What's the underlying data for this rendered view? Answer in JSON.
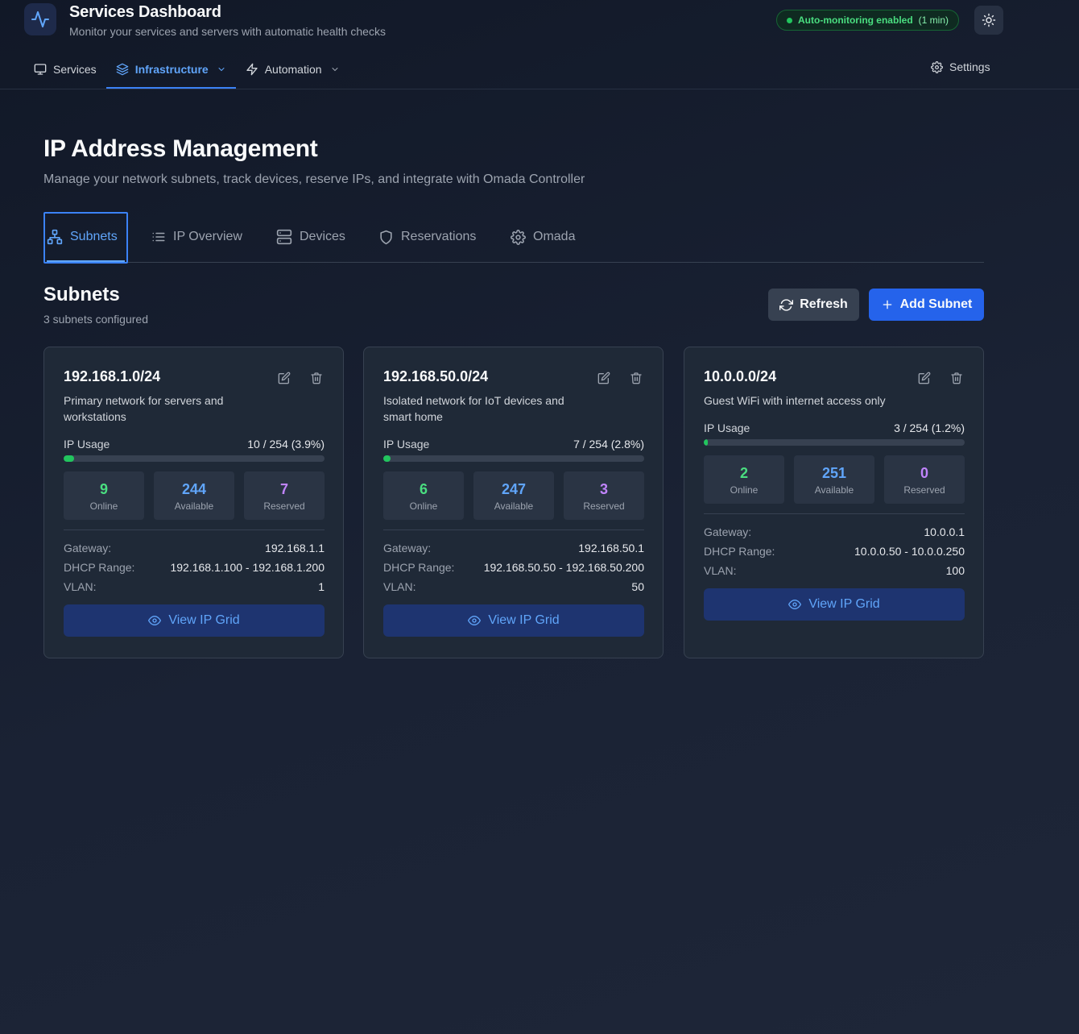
{
  "app": {
    "title": "Services Dashboard",
    "subtitle": "Monitor your services and servers with automatic health checks",
    "monitor_badge": {
      "label": "Auto-monitoring enabled",
      "interval": "(1 min)"
    }
  },
  "nav": {
    "items": [
      {
        "label": "Services",
        "icon": "monitor-icon"
      },
      {
        "label": "Infrastructure",
        "icon": "layers-icon",
        "active": true
      },
      {
        "label": "Automation",
        "icon": "zap-icon"
      }
    ],
    "settings_label": "Settings"
  },
  "page": {
    "title": "IP Address Management",
    "description": "Manage your network subnets, track devices, reserve IPs, and integrate with Omada Controller"
  },
  "tabs": [
    {
      "label": "Subnets",
      "icon": "network-icon",
      "active": true
    },
    {
      "label": "IP Overview",
      "icon": "list-icon"
    },
    {
      "label": "Devices",
      "icon": "server-icon"
    },
    {
      "label": "Reservations",
      "icon": "shield-icon"
    },
    {
      "label": "Omada",
      "icon": "gear-icon"
    }
  ],
  "section": {
    "title": "Subnets",
    "subtitle": "3 subnets configured",
    "refresh_label": "Refresh",
    "add_label": "Add Subnet"
  },
  "labels": {
    "ip_usage": "IP Usage",
    "online": "Online",
    "available": "Available",
    "reserved": "Reserved",
    "gateway": "Gateway:",
    "dhcp_range": "DHCP Range:",
    "vlan": "VLAN:",
    "view_grid": "View IP Grid"
  },
  "subnets": [
    {
      "cidr": "192.168.1.0/24",
      "description": "Primary network for servers and workstations",
      "usage_text": "10 / 254 (3.9%)",
      "usage_fraction": 0.039,
      "online": "9",
      "available": "244",
      "reserved": "7",
      "gateway": "192.168.1.1",
      "dhcp_range": "192.168.1.100 - 192.168.1.200",
      "vlan": "1"
    },
    {
      "cidr": "192.168.50.0/24",
      "description": "Isolated network for IoT devices and smart home",
      "usage_text": "7 / 254 (2.8%)",
      "usage_fraction": 0.028,
      "online": "6",
      "available": "247",
      "reserved": "3",
      "gateway": "192.168.50.1",
      "dhcp_range": "192.168.50.50 - 192.168.50.200",
      "vlan": "50"
    },
    {
      "cidr": "10.0.0.0/24",
      "description": "Guest WiFi with internet access only",
      "usage_text": "3 / 254 (1.2%)",
      "usage_fraction": 0.012,
      "online": "2",
      "available": "251",
      "reserved": "0",
      "gateway": "10.0.0.1",
      "dhcp_range": "10.0.0.50 - 10.0.0.250",
      "vlan": "100"
    }
  ],
  "colors": {
    "accent": "#3b82f6",
    "online": "#4ade80",
    "available": "#60a5fa",
    "reserved": "#c084fc",
    "primary_button": "#2563eb"
  }
}
